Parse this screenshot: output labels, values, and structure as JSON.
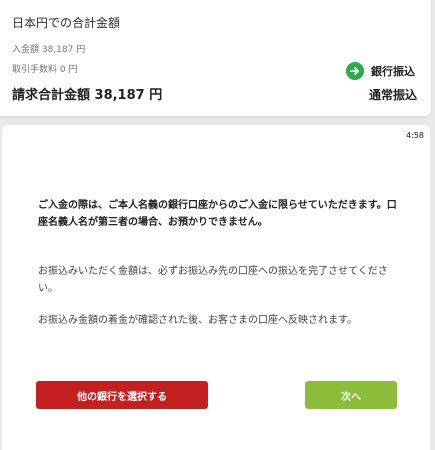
{
  "summary": {
    "heading": "日本円での合計金額",
    "deposit_amount": "入金額 38,187 円",
    "fee": "取引手数料 0 円",
    "total": "請求合計金額 38,187 円",
    "bank_transfer_label": "銀行振込",
    "normal_transfer_label": "通常振込"
  },
  "dialog": {
    "timer": "4:58",
    "notice_bold": "ご入金の際は、ご本人名義の銀行口座からのご入金に限らせていただきます。口座名義人名が第三者の場合、お預かりできません。",
    "notice_amount": "お振込みいただく金額は、必ずお振込み先の口座への振込を完了させてください。",
    "notice_reflect": "お振込み金額の着金が確認された後、お客さまの口座へ反映されます。",
    "other_bank_button": "他の銀行を選択する",
    "next_button": "次へ"
  },
  "colors": {
    "accent_green": "#2fa84f",
    "danger_red": "#c3201f",
    "next_green": "#8bbd3a"
  },
  "icons": {
    "bank_transfer": "arrow-right-circle-icon"
  }
}
